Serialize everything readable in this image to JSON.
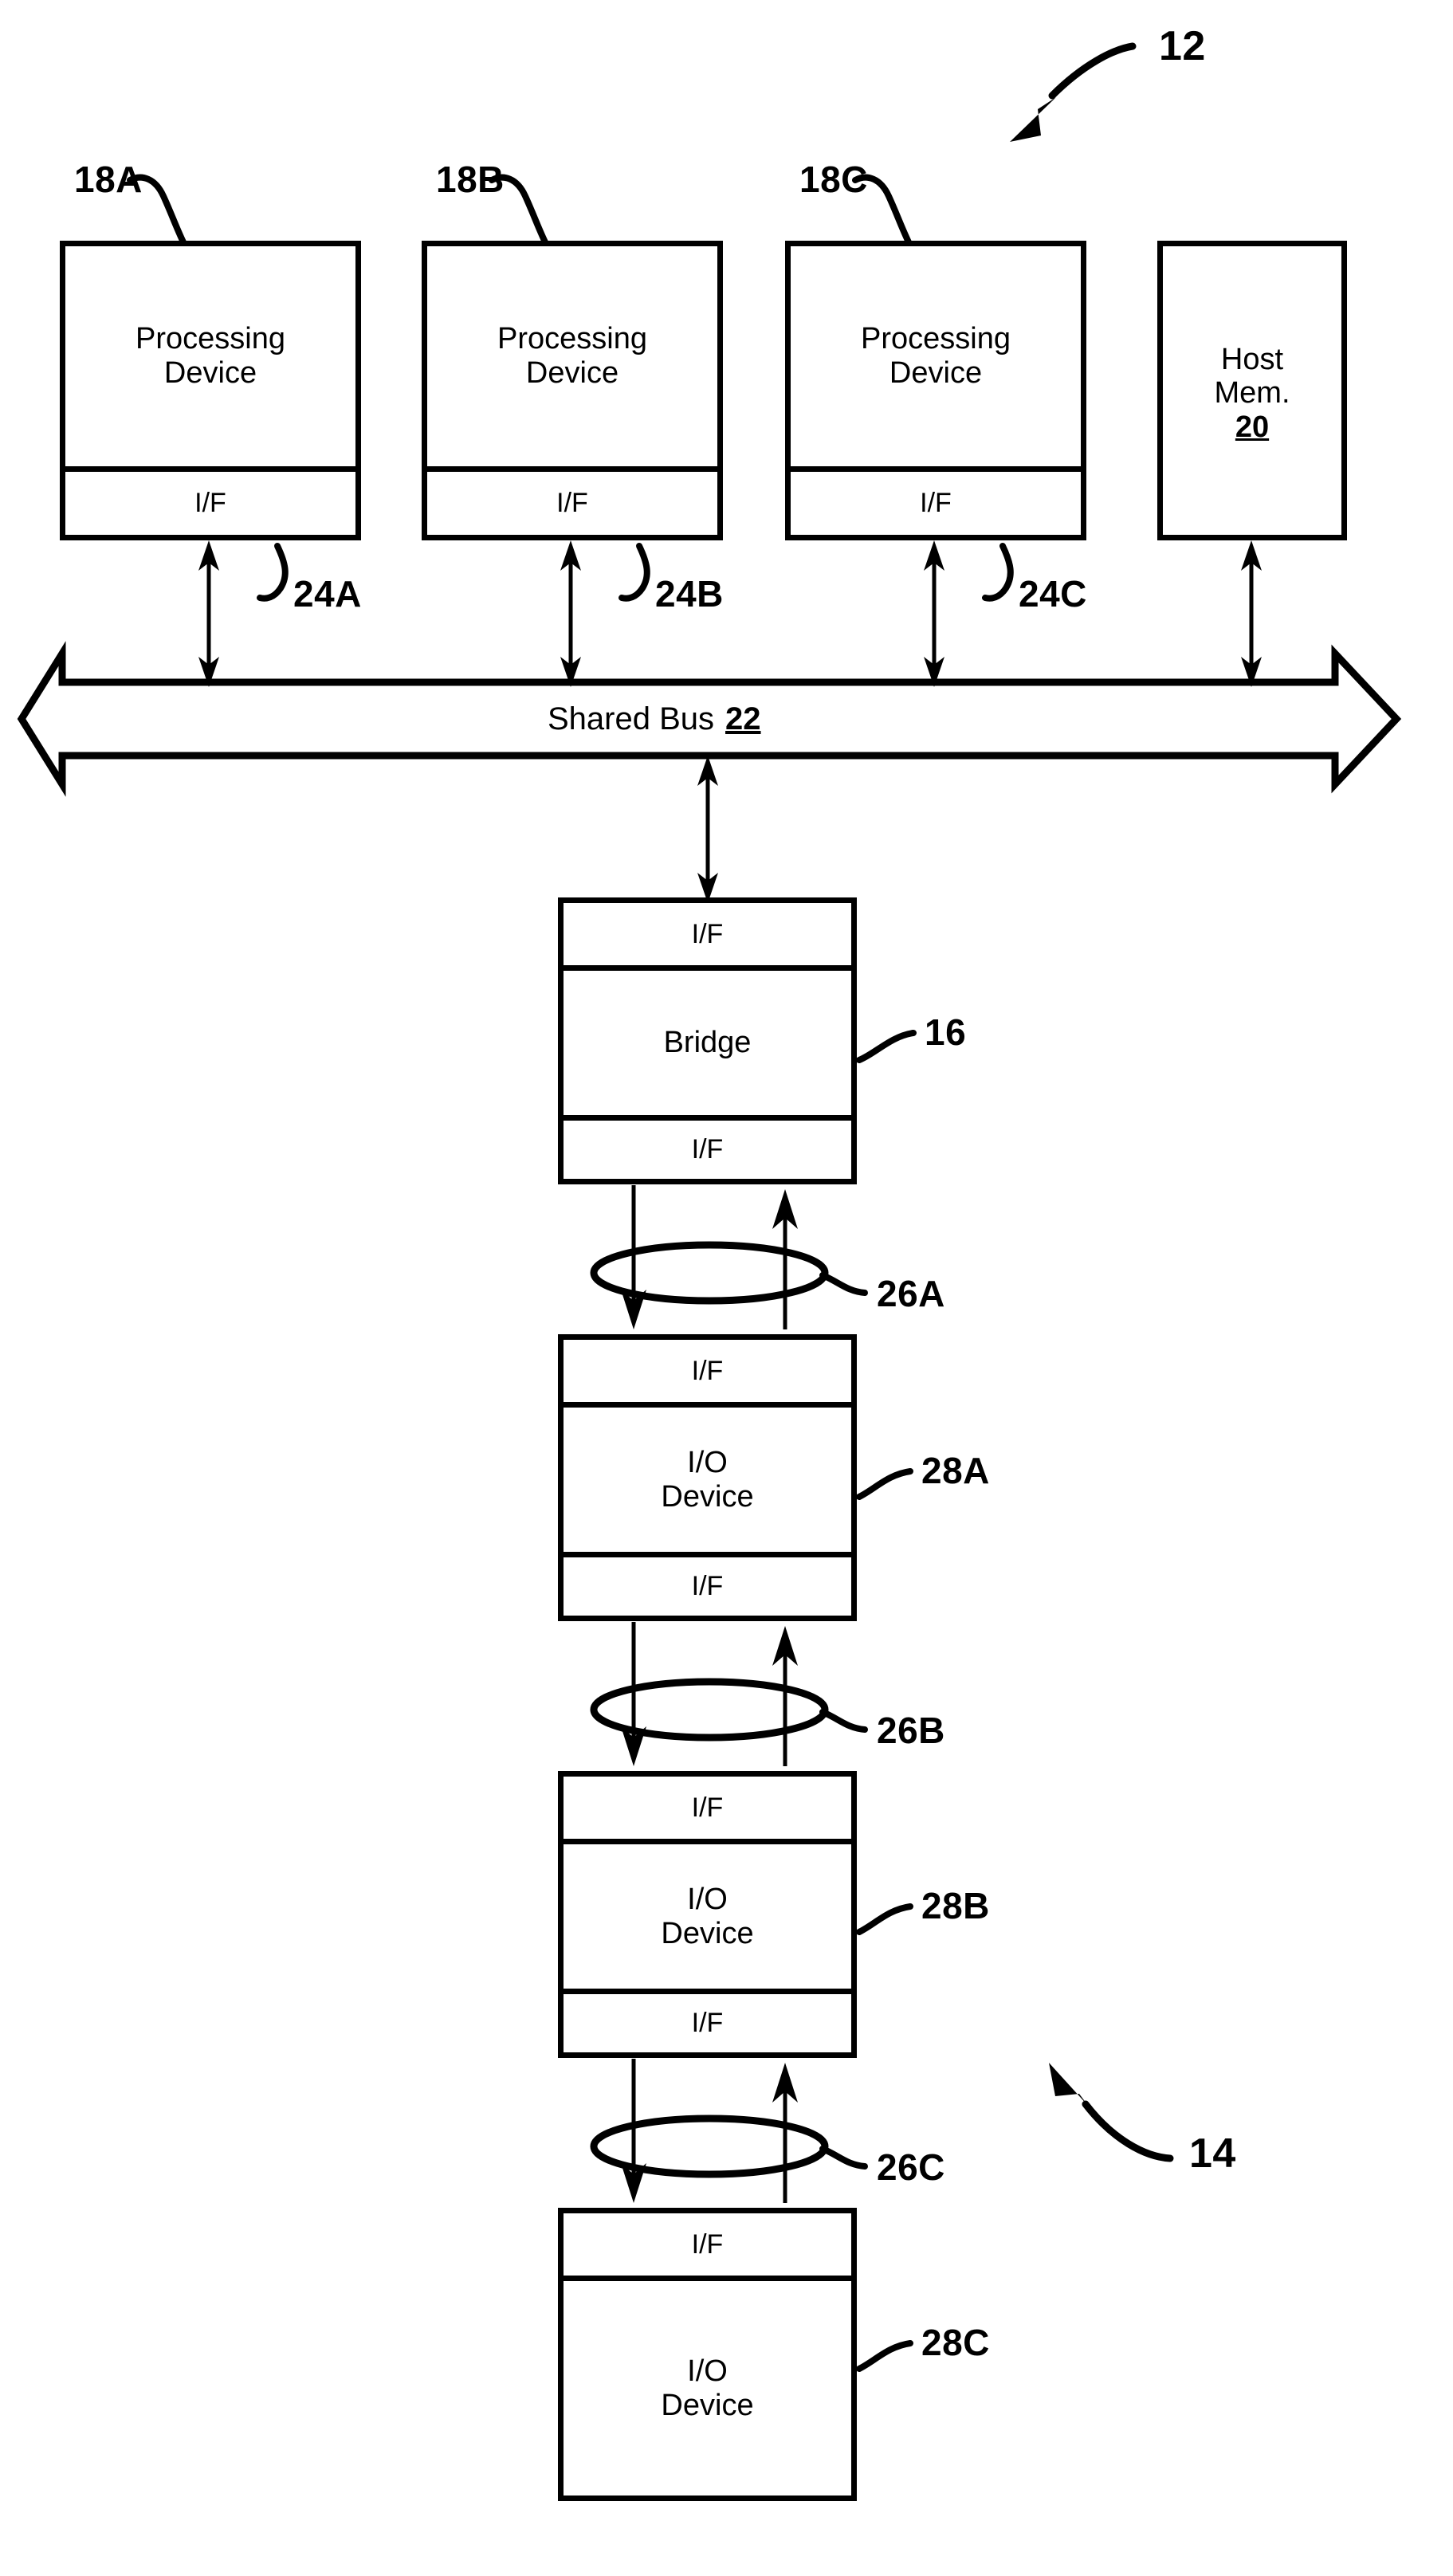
{
  "figure": {
    "system_ref": "12",
    "peripheral_ref": "14",
    "bridge_ref": "16"
  },
  "top_row": {
    "processing_devices": [
      {
        "ref": "18A",
        "title_line1": "Processing",
        "title_line2": "Device",
        "if_label": "I/F",
        "if_ref": "24A"
      },
      {
        "ref": "18B",
        "title_line1": "Processing",
        "title_line2": "Device",
        "if_label": "I/F",
        "if_ref": "24B"
      },
      {
        "ref": "18C",
        "title_line1": "Processing",
        "title_line2": "Device",
        "if_label": "I/F",
        "if_ref": "24C"
      }
    ],
    "host_memory": {
      "line1": "Host",
      "line2": "Mem.",
      "ref": "20"
    }
  },
  "bus": {
    "label": "Shared Bus",
    "ref": "22"
  },
  "bridge": {
    "if_top": "I/F",
    "title": "Bridge",
    "if_bottom": "I/F",
    "ref": "16"
  },
  "links": [
    {
      "ref": "26A"
    },
    {
      "ref": "26B"
    },
    {
      "ref": "26C"
    }
  ],
  "io_devices": [
    {
      "ref": "28A",
      "if_top": "I/F",
      "title_line1": "I/O",
      "title_line2": "Device",
      "if_bottom": "I/F"
    },
    {
      "ref": "28B",
      "if_top": "I/F",
      "title_line1": "I/O",
      "title_line2": "Device",
      "if_bottom": "I/F"
    },
    {
      "ref": "28C",
      "if_top": "I/F",
      "title_line1": "I/O",
      "title_line2": "Device",
      "if_bottom": ""
    }
  ],
  "colors": {
    "stroke": "#000000",
    "background": "#ffffff"
  }
}
